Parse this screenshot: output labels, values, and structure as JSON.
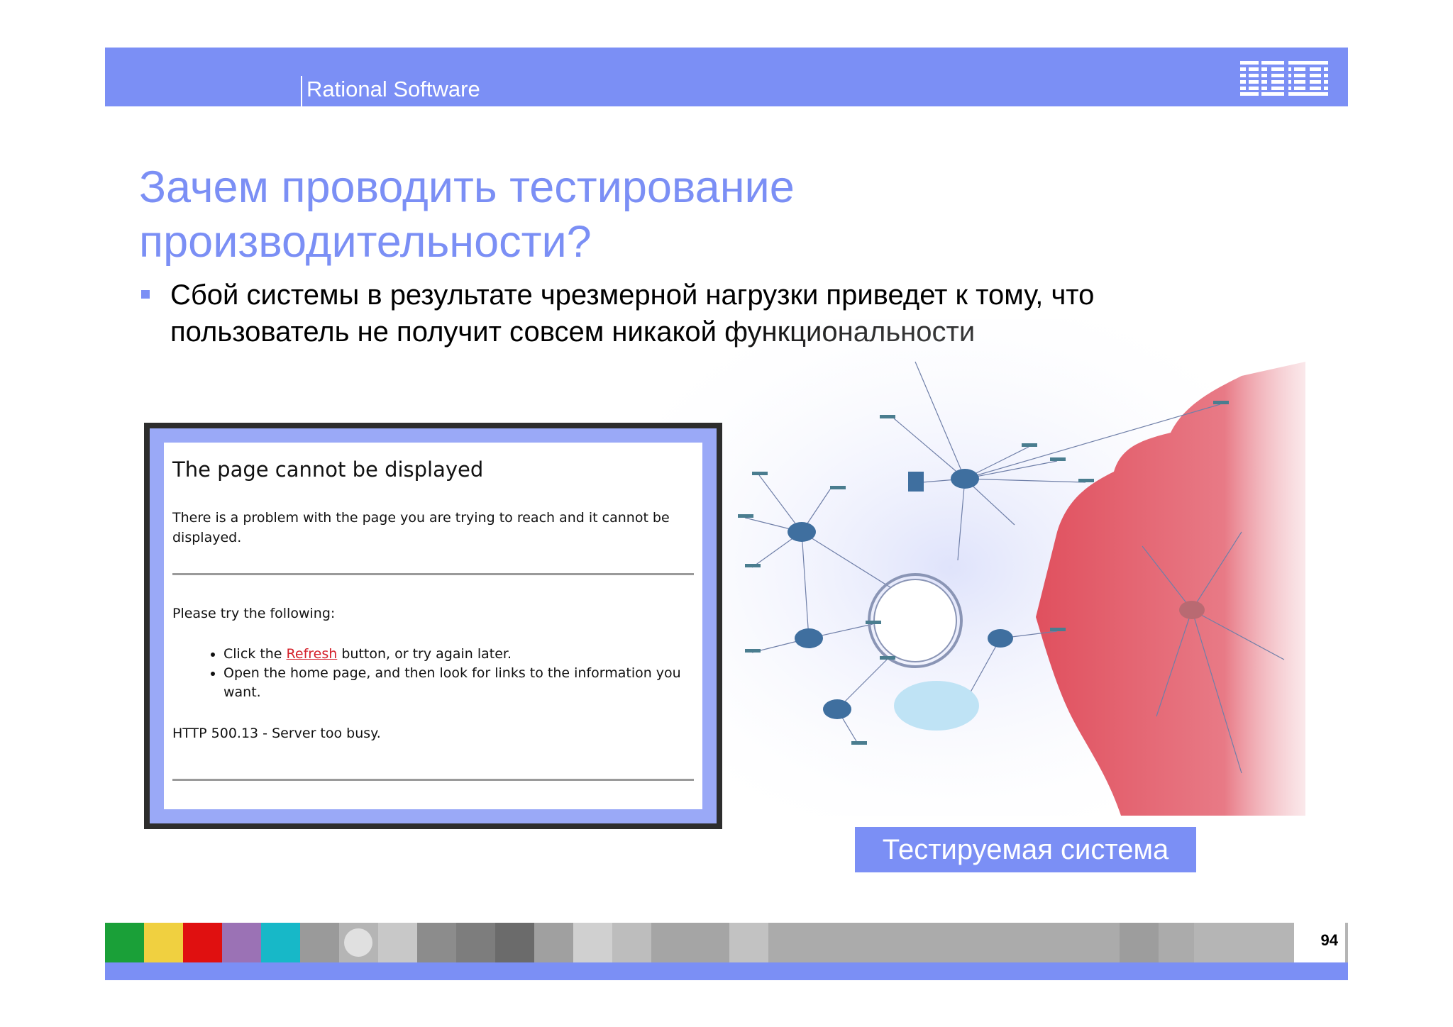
{
  "header": {
    "brand": "Rational Software",
    "logo": "IBM",
    "color": "#7b8ff5"
  },
  "slide": {
    "title": "Зачем проводить тестирование производительности?",
    "bullet": "Сбой системы в результате чрезмерной нагрузки приведет к тому, что пользователь не получит совсем никакой функциональности"
  },
  "error_page": {
    "title": "The page cannot be displayed",
    "message": "There is a problem with the page you are trying to reach and it cannot be displayed.",
    "try_heading": "Please try the following:",
    "item1_before": "Click the ",
    "item1_link": "Refresh",
    "item1_after": " button, or try again later.",
    "item2": "Open the home page, and then look for links to the information you want.",
    "code": "HTTP 500.13 - Server too busy."
  },
  "caption": "Тестируемая система",
  "footer": {
    "page_number": "94",
    "palette": [
      "#1aa038",
      "#f0d040",
      "#e01010",
      "#9b72b5",
      "#17b8c8"
    ]
  }
}
